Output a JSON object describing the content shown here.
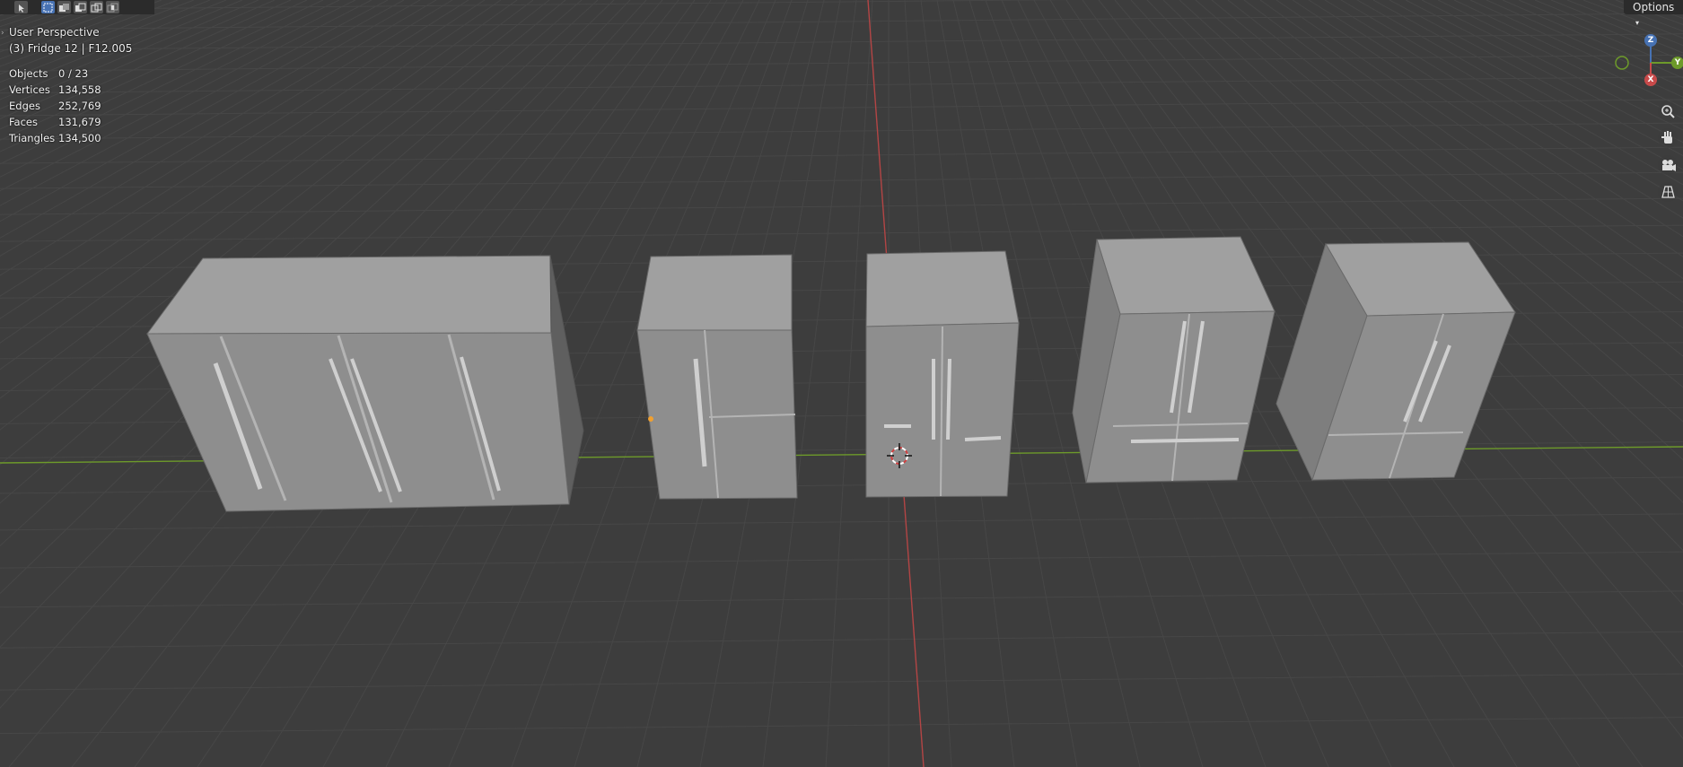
{
  "viewport": {
    "perspective_label": "User Perspective",
    "object_label": "(3) Fridge 12 | F12.005"
  },
  "stats": {
    "objects_label": "Objects",
    "objects_value": "0 / 23",
    "vertices_label": "Vertices",
    "vertices_value": "134,558",
    "edges_label": "Edges",
    "edges_value": "252,769",
    "faces_label": "Faces",
    "faces_value": "131,679",
    "triangles_label": "Triangles",
    "triangles_value": "134,500"
  },
  "header": {
    "options_label": "Options"
  },
  "gizmo": {
    "z_label": "Z",
    "y_label": "Y",
    "x_label": "X"
  },
  "colors": {
    "background": "#3d3d3d",
    "grid": "#4a4a4a",
    "x_axis": "#b34545",
    "y_axis": "#6d9a2a",
    "model": "#9a9a9a",
    "accent_blue": "#4772b3"
  },
  "icons": [
    "select-tool-icon",
    "mode-new-icon",
    "mode-extend-icon",
    "mode-subtract-icon",
    "mode-invert-icon",
    "mode-intersect-icon",
    "zoom-icon",
    "hand-pan-icon",
    "camera-icon",
    "grid-view-icon"
  ]
}
